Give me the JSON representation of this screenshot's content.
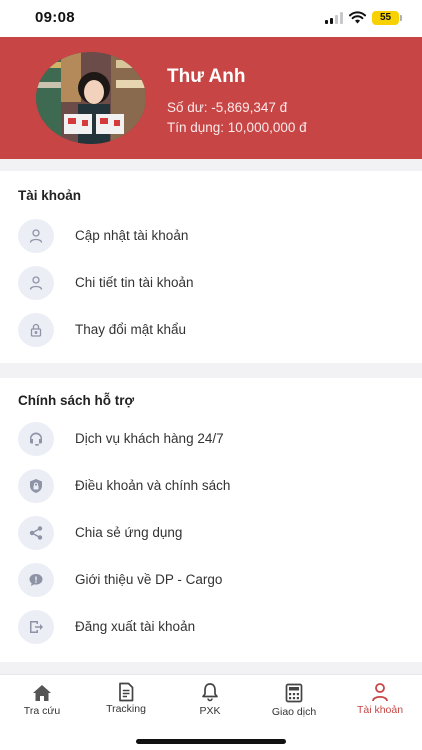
{
  "status_bar": {
    "time": "09:08",
    "battery": "55"
  },
  "profile": {
    "name": "Thư Anh",
    "balance": "Số dư: -5,869,347 đ",
    "credit": "Tín dụng: 10,000,000 đ"
  },
  "account_section": {
    "title": "Tài khoản",
    "items": [
      {
        "label": "Cập nhật tài khoản",
        "icon": "user-icon"
      },
      {
        "label": "Chi tiết tin tài khoản",
        "icon": "user-icon"
      },
      {
        "label": "Thay đổi mật khẩu",
        "icon": "lock-icon"
      }
    ]
  },
  "support_section": {
    "title": "Chính sách hỗ trợ",
    "items": [
      {
        "label": "Dịch vụ khách hàng 24/7",
        "icon": "headset-icon"
      },
      {
        "label": "Điều khoản và chính sách",
        "icon": "shield-icon"
      },
      {
        "label": "Chia sẻ ứng dụng",
        "icon": "share-icon"
      },
      {
        "label": "Giới thiệu về DP - Cargo",
        "icon": "info-chat-icon"
      },
      {
        "label": "Đăng xuất tài khoản",
        "icon": "logout-icon"
      }
    ]
  },
  "tabs": [
    {
      "label": "Tra cứu",
      "icon": "home-icon",
      "active": false
    },
    {
      "label": "Tracking",
      "icon": "document-icon",
      "active": false
    },
    {
      "label": "PXK",
      "icon": "bell-icon",
      "active": false
    },
    {
      "label": "Giao dịch",
      "icon": "calculator-icon",
      "active": false
    },
    {
      "label": "Tài khoản",
      "icon": "person-icon",
      "active": true
    }
  ],
  "colors": {
    "brand": "#c84545",
    "icon_bg": "#eceef6",
    "icon_fg": "#8e93a6"
  }
}
